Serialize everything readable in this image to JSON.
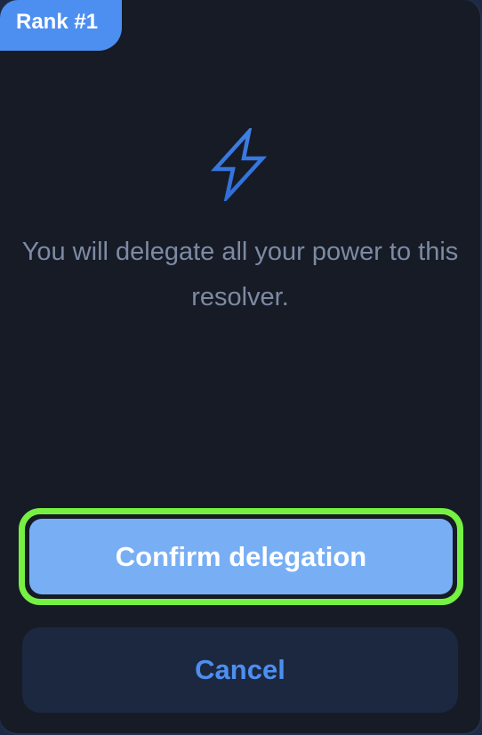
{
  "badge": {
    "label": "Rank #1"
  },
  "icon": {
    "name": "lightning-bolt-icon",
    "color": "#3e82e8"
  },
  "message": {
    "text": "You will delegate all your power to this resolver."
  },
  "actions": {
    "confirm_label": "Confirm delegation",
    "cancel_label": "Cancel"
  },
  "colors": {
    "background": "#161b26",
    "accent": "#4d8ff0",
    "confirm_fill": "#78aff4",
    "focus_ring": "#76f042",
    "cancel_fill": "#1c2840",
    "message_text": "#7d8aa3"
  }
}
